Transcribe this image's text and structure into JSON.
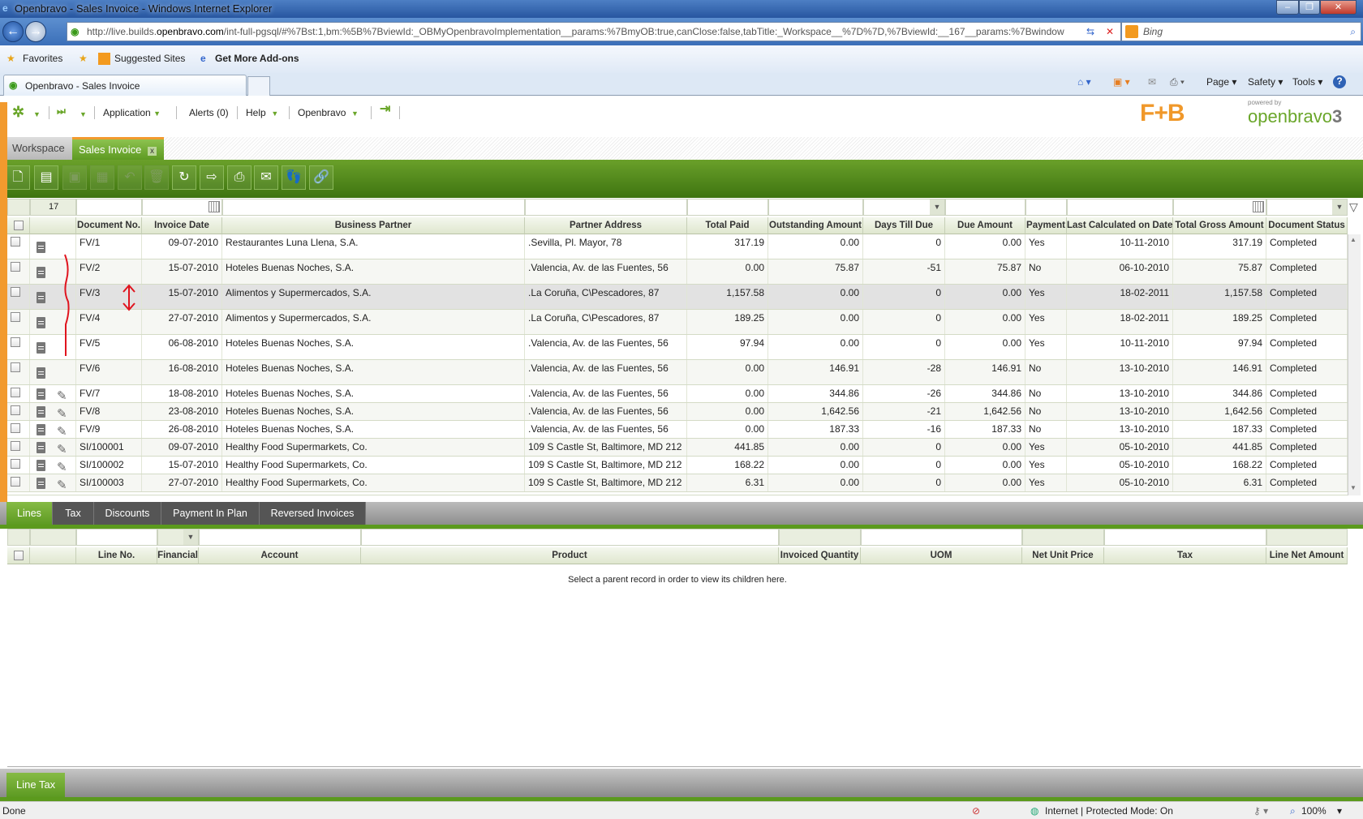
{
  "browser": {
    "title": "Openbravo - Sales Invoice - Windows Internet Explorer",
    "url_pre": "http://live.builds.",
    "url_host": "openbravo.com",
    "url_post": "/int-full-pgsql/#%7Bst:1,bm:%5B%7BviewId:_OBMyOpenbravoImplementation__params:%7BmyOB:true,canClose:false,tabTitle:_Workspace__%7D%7D,%7BviewId:__167__params:%7Bwindow",
    "search_placeholder": "Bing",
    "favorites": "Favorites",
    "suggested": "Suggested Sites",
    "addons": "Get More Add-ons",
    "tab": "Openbravo - Sales Invoice",
    "cmd": {
      "page": "Page",
      "safety": "Safety",
      "tools": "Tools"
    },
    "status": "Done",
    "zone": "Internet | Protected Mode: On",
    "zoom": "100%"
  },
  "app": {
    "menu": {
      "application": "Application",
      "alerts": "Alerts (0)",
      "help": "Help",
      "openbravo": "Openbravo"
    },
    "logo1": "F+B",
    "logo2": "openbravo 3",
    "tabs": {
      "workspace": "Workspace",
      "sales_invoice": "Sales Invoice"
    },
    "accent": "#5d9a22",
    "orange": "#f29a2e"
  },
  "grid": {
    "count": "17",
    "columns": [
      "Document No.",
      "Invoice Date",
      "Business Partner",
      "Partner Address",
      "Total Paid",
      "Outstanding Amount",
      "Days Till Due",
      "Due Amount",
      "Payment",
      "Last Calculated on Date",
      "Total Gross Amount",
      "Document Status"
    ],
    "rows": [
      [
        "FV/1",
        "09-07-2010",
        "Restaurantes Luna Llena, S.A.",
        ".Sevilla, Pl. Mayor, 78",
        "317.19",
        "0.00",
        "0",
        "0.00",
        "Yes",
        "10-11-2010",
        "317.19",
        "Completed"
      ],
      [
        "FV/2",
        "15-07-2010",
        "Hoteles Buenas Noches, S.A.",
        ".Valencia, Av. de las Fuentes, 56",
        "0.00",
        "75.87",
        "-51",
        "75.87",
        "No",
        "06-10-2010",
        "75.87",
        "Completed"
      ],
      [
        "FV/3",
        "15-07-2010",
        "Alimentos y Supermercados, S.A.",
        ".La Coruña, C\\Pescadores, 87",
        "1,157.58",
        "0.00",
        "0",
        "0.00",
        "Yes",
        "18-02-2011",
        "1,157.58",
        "Completed"
      ],
      [
        "FV/4",
        "27-07-2010",
        "Alimentos y Supermercados, S.A.",
        ".La Coruña, C\\Pescadores, 87",
        "189.25",
        "0.00",
        "0",
        "0.00",
        "Yes",
        "18-02-2011",
        "189.25",
        "Completed"
      ],
      [
        "FV/5",
        "06-08-2010",
        "Hoteles Buenas Noches, S.A.",
        ".Valencia, Av. de las Fuentes, 56",
        "97.94",
        "0.00",
        "0",
        "0.00",
        "Yes",
        "10-11-2010",
        "97.94",
        "Completed"
      ],
      [
        "FV/6",
        "16-08-2010",
        "Hoteles Buenas Noches, S.A.",
        ".Valencia, Av. de las Fuentes, 56",
        "0.00",
        "146.91",
        "-28",
        "146.91",
        "No",
        "13-10-2010",
        "146.91",
        "Completed"
      ],
      [
        "FV/7",
        "18-08-2010",
        "Hoteles Buenas Noches, S.A.",
        ".Valencia, Av. de las Fuentes, 56",
        "0.00",
        "344.86",
        "-26",
        "344.86",
        "No",
        "13-10-2010",
        "344.86",
        "Completed"
      ],
      [
        "FV/8",
        "23-08-2010",
        "Hoteles Buenas Noches, S.A.",
        ".Valencia, Av. de las Fuentes, 56",
        "0.00",
        "1,642.56",
        "-21",
        "1,642.56",
        "No",
        "13-10-2010",
        "1,642.56",
        "Completed"
      ],
      [
        "FV/9",
        "26-08-2010",
        "Hoteles Buenas Noches, S.A.",
        ".Valencia, Av. de las Fuentes, 56",
        "0.00",
        "187.33",
        "-16",
        "187.33",
        "No",
        "13-10-2010",
        "187.33",
        "Completed"
      ],
      [
        "SI/100001",
        "09-07-2010",
        "Healthy Food Supermarkets, Co.",
        "109 S Castle St, Baltimore, MD 212",
        "441.85",
        "0.00",
        "0",
        "0.00",
        "Yes",
        "05-10-2010",
        "441.85",
        "Completed"
      ],
      [
        "SI/100002",
        "15-07-2010",
        "Healthy Food Supermarkets, Co.",
        "109 S Castle St, Baltimore, MD 212",
        "168.22",
        "0.00",
        "0",
        "0.00",
        "Yes",
        "05-10-2010",
        "168.22",
        "Completed"
      ],
      [
        "SI/100003",
        "27-07-2010",
        "Healthy Food Supermarkets, Co.",
        "109 S Castle St, Baltimore, MD 212",
        "6.31",
        "0.00",
        "0",
        "0.00",
        "Yes",
        "05-10-2010",
        "6.31",
        "Completed"
      ]
    ]
  },
  "child": {
    "tabs": [
      "Lines",
      "Tax",
      "Discounts",
      "Payment In Plan",
      "Reversed Invoices"
    ],
    "columns": [
      "Line No.",
      "Financial",
      "Account",
      "Product",
      "Invoiced Quantity",
      "UOM",
      "Net Unit Price",
      "Tax",
      "Line Net Amount"
    ],
    "message": "Select a parent record in order to view its children here.",
    "bottom_tab": "Line Tax"
  }
}
